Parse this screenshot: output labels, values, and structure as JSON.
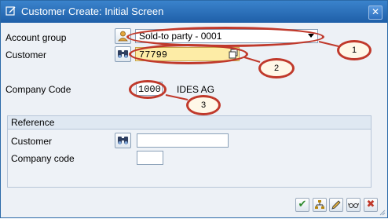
{
  "window": {
    "title": "Customer Create: Initial Screen",
    "close_label": "✕"
  },
  "form": {
    "account_group": {
      "label": "Account group",
      "value": "Sold-to party - 0001"
    },
    "customer": {
      "label": "Customer",
      "value": "77799"
    },
    "company_code": {
      "label": "Company Code",
      "value": "1000",
      "description": "IDES AG"
    }
  },
  "reference": {
    "header": "Reference",
    "customer": {
      "label": "Customer",
      "value": ""
    },
    "company_code": {
      "label": "Company code",
      "value": ""
    }
  },
  "callouts": {
    "one": "1",
    "two": "2",
    "three": "3"
  },
  "toolbar": {
    "confirm_glyph": "✔",
    "cancel_glyph": "✖"
  },
  "colors": {
    "titlebar": "#1f5fa8",
    "callout": "#c0392b",
    "required_field": "#fdeca6"
  }
}
